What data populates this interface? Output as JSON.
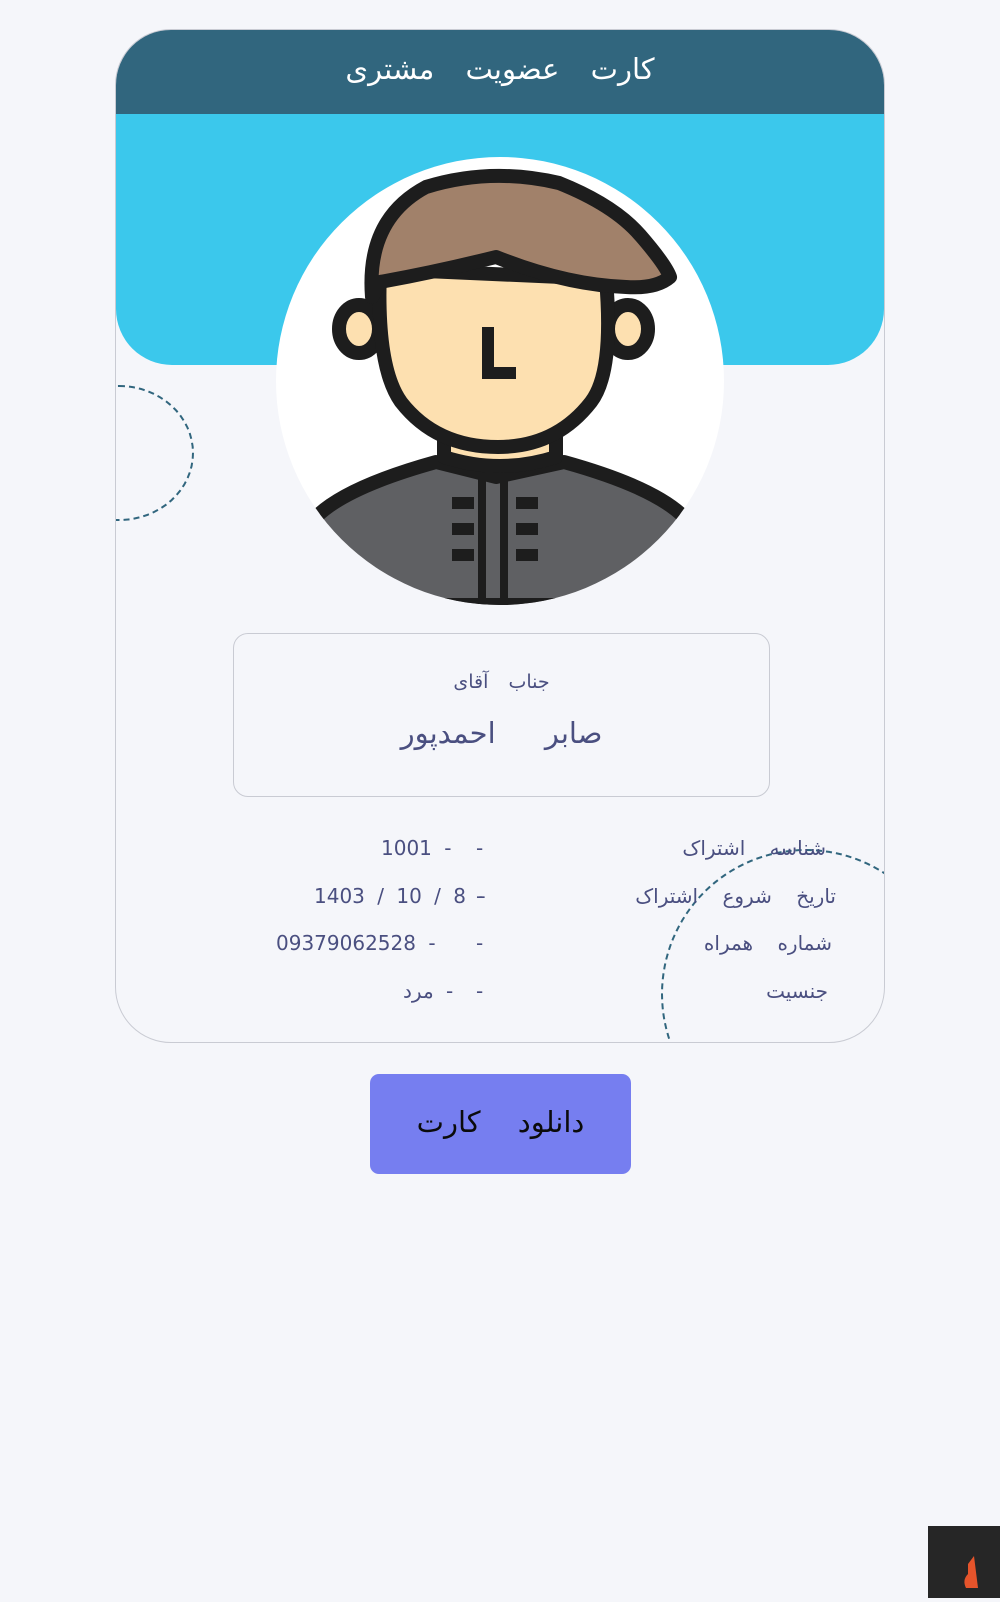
{
  "card": {
    "title": "کارت عضویت مشتری"
  },
  "customer": {
    "honorific": "جناب آقای",
    "full_name": "صابر احمدپور"
  },
  "info": [
    {
      "label": "شناسه اشتراک",
      "separator": "-",
      "value": "1001 -"
    },
    {
      "label": "تاریخ شروع اشتراک",
      "separator": "-",
      "value": "1403 / 10 / 8 -"
    },
    {
      "label": "شماره همراه",
      "separator": "-",
      "value": "09379062528 -"
    },
    {
      "label": "جنسیت",
      "separator": "-",
      "value": "مرد -"
    }
  ],
  "actions": {
    "download_label": "دانلود کارت"
  },
  "icons": {
    "avatar": "man-avatar-icon",
    "corner": "flame-logo-icon"
  },
  "colors": {
    "header": "#31667e",
    "banner": "#3bc8ec",
    "button": "#767ef0",
    "text": "#4a4f80",
    "background": "#f5f6fa"
  }
}
